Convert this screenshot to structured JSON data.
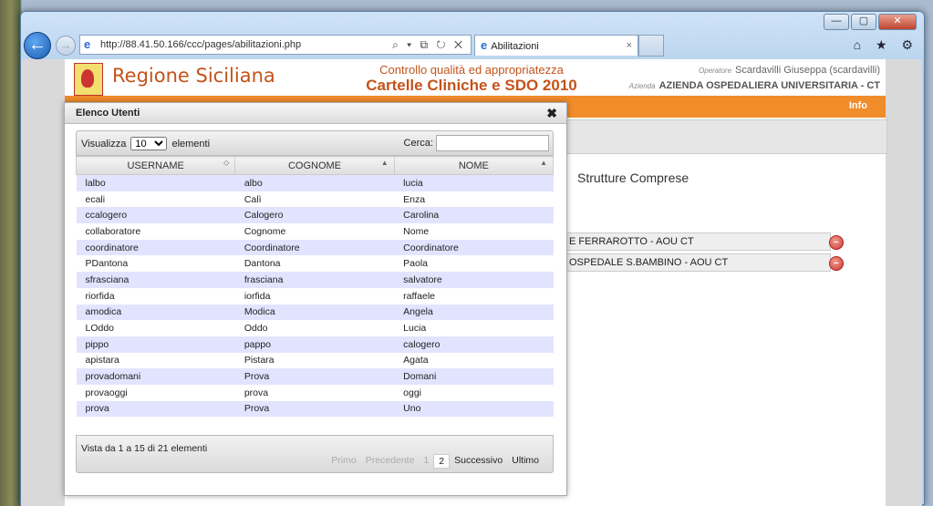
{
  "browser": {
    "url": "http://88.41.50.166/ccc/pages/abilitazioni.php",
    "url_host": "88.41.50.166",
    "tab_title": "Abilitazioni",
    "address_tools": "⌕ ▾ ⧉ ↻ ✕",
    "window_buttons": {
      "minimize": "—",
      "maximize": "▢",
      "close": "✕"
    },
    "right_icons": "⌂ ★ ⚙",
    "icons": [
      "back-icon",
      "forward-icon",
      "ie-icon",
      "search-icon",
      "refresh-icon",
      "stop-icon",
      "home-icon",
      "favorites-icon",
      "gear-icon"
    ]
  },
  "header": {
    "brand": "Regione Siciliana",
    "center_line1": "Controllo qualità ed appropriatezza",
    "center_line2": "Cartelle Cliniche e SDO 2010",
    "operator_label": "Operatore",
    "operator_name": "Scardavilli Giuseppa (scardavilli)",
    "azienda_label": "Azienda",
    "azienda_name": "AZIENDA OSPEDALIERA UNIVERSITARIA - CT"
  },
  "menubar": {
    "info": "Info",
    "color": "#f08c2a"
  },
  "right_panel": {
    "section_title": "Strutture Comprese",
    "structures": [
      "E FERRAROTTO - AOU CT",
      "OSPEDALE S.BAMBINO - AOU CT"
    ]
  },
  "dialog": {
    "title": "Elenco Utenti",
    "close": "✖",
    "length_prefix": "Visualizza",
    "length_value": "10",
    "length_suffix": "elementi",
    "search_label": "Cerca:",
    "search_value": "",
    "columns": [
      "USERNAME",
      "COGNOME",
      "NOME"
    ],
    "rows": [
      [
        "lalbo",
        "albo",
        "lucia"
      ],
      [
        "ecali",
        "Calì",
        "Enza"
      ],
      [
        "ccalogero",
        "Calogero",
        "Carolina"
      ],
      [
        "collaboratore",
        "Cognome",
        "Nome"
      ],
      [
        "coordinatore",
        "Coordinatore",
        "Coordinatore"
      ],
      [
        "PDantona",
        "Dantona",
        "Paola"
      ],
      [
        "sfrasciana",
        "frasciana",
        "salvatore"
      ],
      [
        "riorfida",
        "iorfida",
        "raffaele"
      ],
      [
        "amodica",
        "Modica",
        "Angela"
      ],
      [
        "LOddo",
        "Oddo",
        "Lucia"
      ],
      [
        "pippo",
        "pappo",
        "calogero"
      ],
      [
        "apistara",
        "Pistara",
        "Agata"
      ],
      [
        "provadomani",
        "Prova",
        "Domani"
      ],
      [
        "provaoggi",
        "prova",
        "oggi"
      ],
      [
        "prova",
        "Prova",
        "Uno"
      ]
    ],
    "info": "Vista da 1 a 15 di 21 elementi",
    "pager": {
      "first": "Primo",
      "prev": "Precedente",
      "p1": "1",
      "p2": "2",
      "next": "Successivo",
      "last": "Ultimo"
    }
  }
}
